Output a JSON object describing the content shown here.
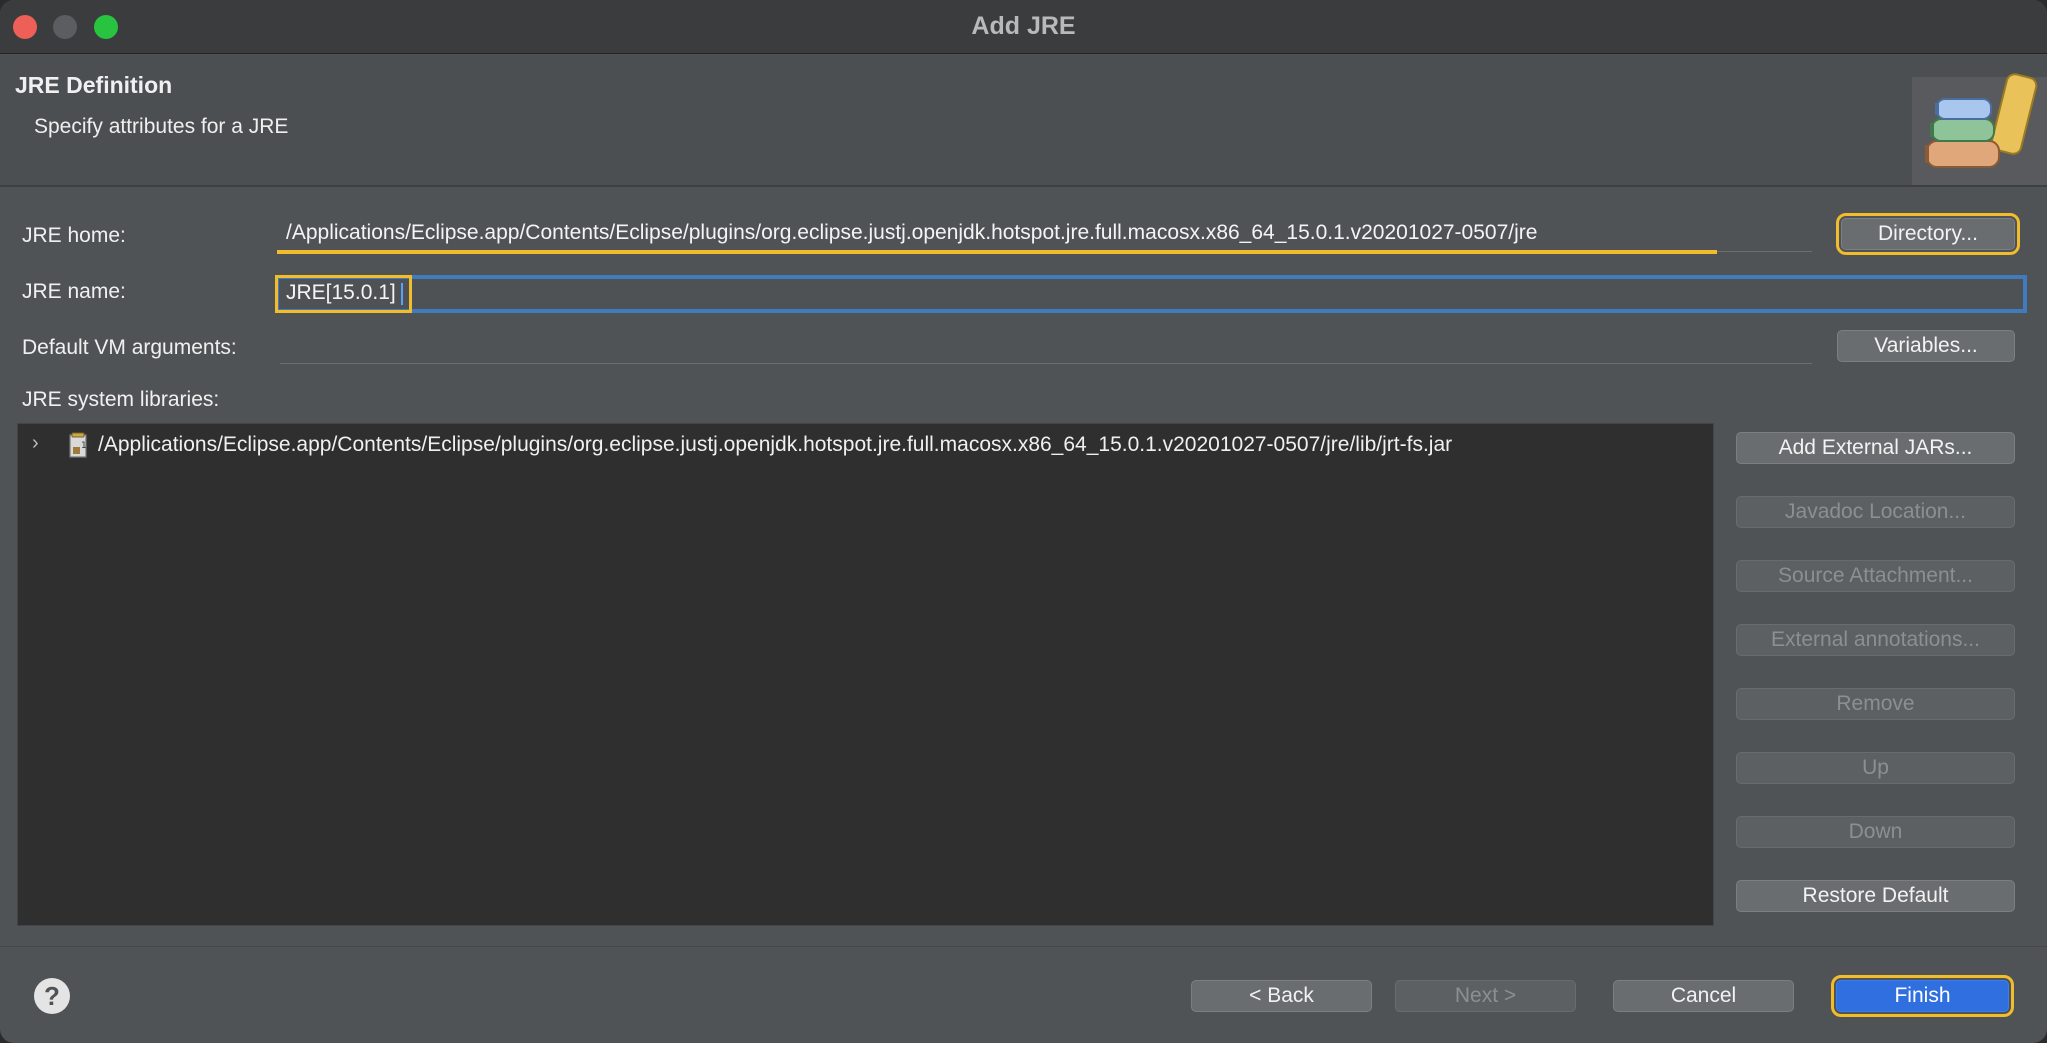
{
  "window": {
    "title": "Add JRE"
  },
  "header": {
    "title": "JRE Definition",
    "description": "Specify attributes for a JRE",
    "icon": "library-books-icon"
  },
  "form": {
    "jre_home_label": "JRE home:",
    "jre_home_value": "/Applications/Eclipse.app/Contents/Eclipse/plugins/org.eclipse.justj.openjdk.hotspot.jre.full.macosx.x86_64_15.0.1.v20201027-0507/jre",
    "directory_button": "Directory...",
    "jre_name_label": "JRE name:",
    "jre_name_value": "JRE[15.0.1]",
    "vm_args_label": "Default VM arguments:",
    "vm_args_value": "",
    "variables_button": "Variables...",
    "libraries_label": "JRE system libraries:"
  },
  "libraries": [
    {
      "path": "/Applications/Eclipse.app/Contents/Eclipse/plugins/org.eclipse.justj.openjdk.hotspot.jre.full.macosx.x86_64_15.0.1.v20201027-0507/jre/lib/jrt-fs.jar",
      "icon": "jar-file-icon",
      "expanded": false
    }
  ],
  "library_buttons": {
    "add_external": "Add External JARs...",
    "javadoc": "Javadoc Location...",
    "source": "Source Attachment...",
    "annotations": "External annotations...",
    "remove": "Remove",
    "up": "Up",
    "down": "Down",
    "restore": "Restore Default"
  },
  "footer": {
    "back": "< Back",
    "next": "Next >",
    "cancel": "Cancel",
    "finish": "Finish",
    "help": "?"
  },
  "colors": {
    "highlight": "#f1bd2c",
    "focus": "#3f7bbd",
    "primary": "#2f6fe0"
  }
}
